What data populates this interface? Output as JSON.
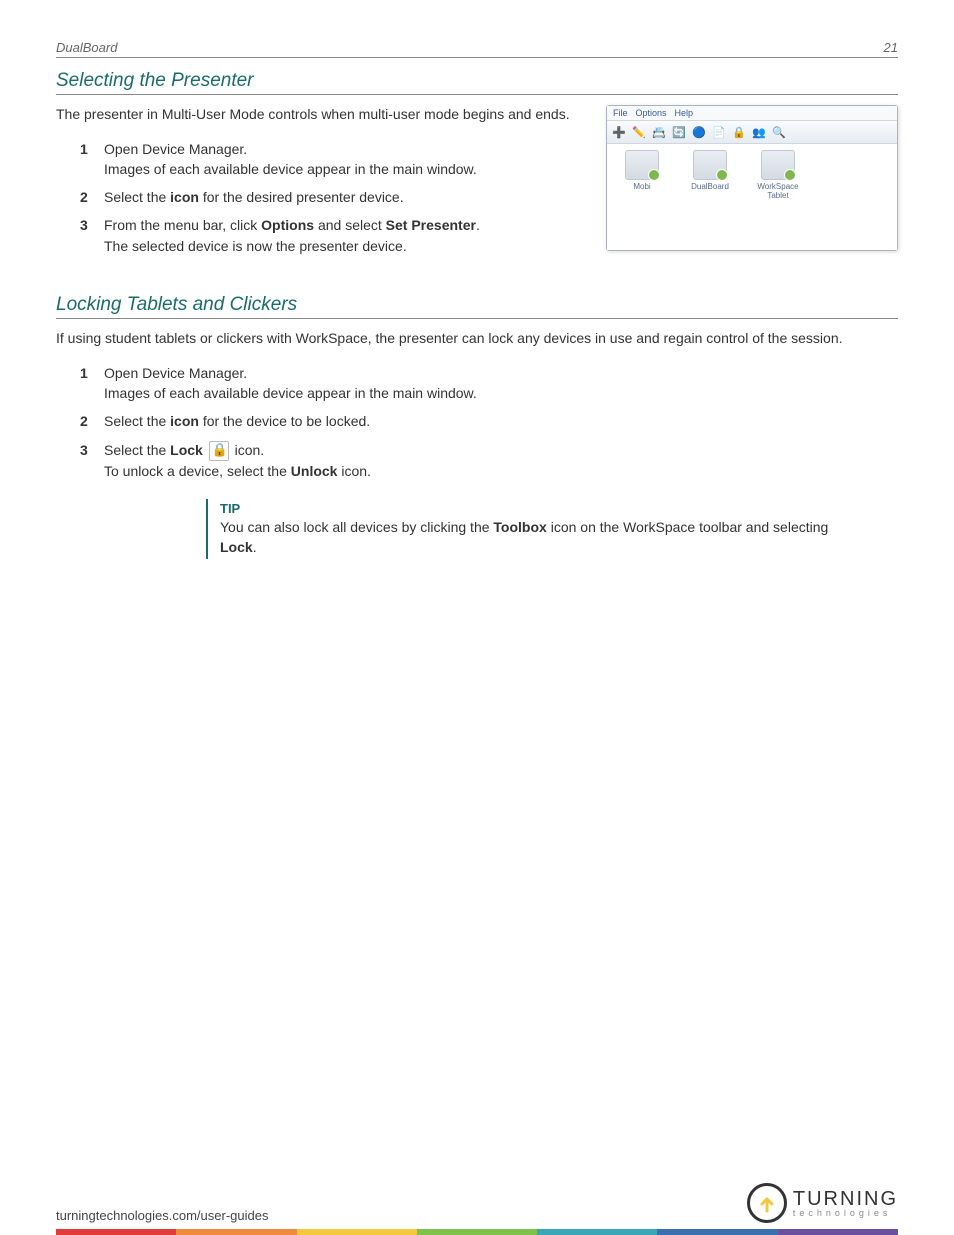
{
  "header": {
    "title": "DualBoard",
    "page_number": "21"
  },
  "section1": {
    "heading": "Selecting the Presenter",
    "intro": "The presenter in Multi-User Mode controls when multi-user mode begins and ends.",
    "steps": [
      {
        "num": "1",
        "t1": "Open Device Manager.",
        "t2": "Images of each available device appear in the main window."
      },
      {
        "num": "2",
        "t1a": "Select the ",
        "b1": "icon",
        "t1b": " for the desired presenter device."
      },
      {
        "num": "3",
        "t1a": "From the menu bar, click ",
        "b1": "Options",
        "t1b": " and select ",
        "b2": "Set Presenter",
        "t1c": ".",
        "t2": "The selected device is now the presenter device."
      }
    ]
  },
  "app_window": {
    "menu": {
      "file": "File",
      "options": "Options",
      "help": "Help"
    },
    "toolbar_icons": [
      "➕",
      "✏️",
      "📇",
      "🔄",
      "🔵",
      "📄",
      "🔒",
      "👥",
      "🔍"
    ],
    "devices": [
      {
        "label": "Mobi"
      },
      {
        "label": "DualBoard"
      },
      {
        "label": "WorkSpace Tablet"
      }
    ]
  },
  "section2": {
    "heading": "Locking Tablets and Clickers",
    "intro": "If using student tablets or clickers with WorkSpace, the presenter can lock any devices in use and regain control of the session.",
    "steps": [
      {
        "num": "1",
        "t1": "Open Device Manager.",
        "t2": "Images of each available device appear in the main window."
      },
      {
        "num": "2",
        "t1a": "Select the ",
        "b1": "icon",
        "t1b": " for the device to be locked."
      },
      {
        "num": "3",
        "t1a": "Select the ",
        "b1": "Lock",
        "t1b": " icon.",
        "t2a": "To unlock a device, select the ",
        "b2": "Unlock",
        "t2b": " icon."
      }
    ],
    "tip": {
      "label": "TIP",
      "t1": "You can also lock all devices by clicking the ",
      "b1": "Toolbox",
      "t2": " icon on the WorkSpace toolbar and selecting ",
      "b2": "Lock",
      "t3": "."
    }
  },
  "footer": {
    "url": "turningtechnologies.com/user-guides",
    "logo_top": "TURNING",
    "logo_bot": "technologies"
  }
}
